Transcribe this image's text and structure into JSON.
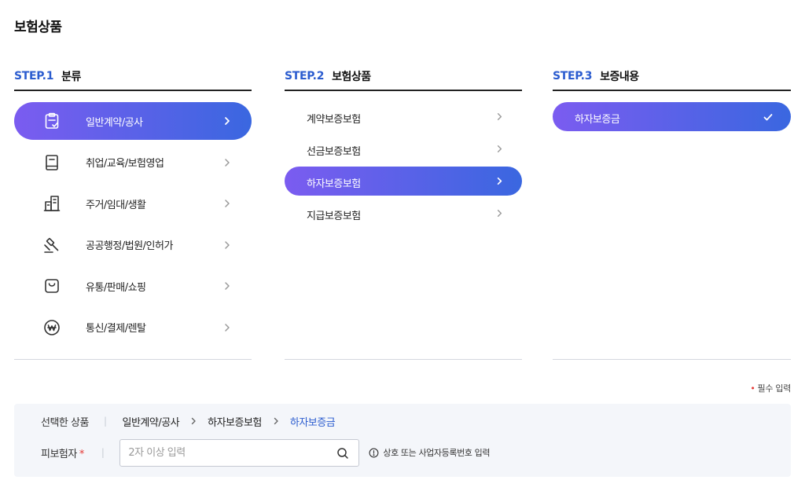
{
  "page": {
    "title": "보험상품"
  },
  "steps": [
    {
      "no": "STEP.1",
      "name": "분류"
    },
    {
      "no": "STEP.2",
      "name": "보험상품"
    },
    {
      "no": "STEP.3",
      "name": "보증내용"
    }
  ],
  "categories": [
    {
      "label": "일반계약/공사",
      "icon": "clipboard-check-icon",
      "active": true
    },
    {
      "label": "취업/교육/보험영업",
      "icon": "book-icon",
      "active": false
    },
    {
      "label": "주거/임대/생활",
      "icon": "building-icon",
      "active": false
    },
    {
      "label": "공공행정/법원/인허가",
      "icon": "gavel-icon",
      "active": false
    },
    {
      "label": "유통/판매/쇼핑",
      "icon": "shopping-bag-icon",
      "active": false
    },
    {
      "label": "통신/결제/렌탈",
      "icon": "won-coin-icon",
      "active": false
    }
  ],
  "products": [
    {
      "label": "계약보증보험",
      "active": false
    },
    {
      "label": "선금보증보험",
      "active": false
    },
    {
      "label": "하자보증보험",
      "active": true
    },
    {
      "label": "지급보증보험",
      "active": false
    }
  ],
  "coverages": [
    {
      "label": "하자보증금",
      "selected": true
    }
  ],
  "required_note": "필수 입력",
  "summary": {
    "selected_label": "선택한 상품",
    "path": [
      "일반계약/공사",
      "하자보증보험",
      "하자보증금"
    ],
    "insured_label": "피보험자",
    "search": {
      "placeholder": "2자 이상 입력",
      "value": ""
    },
    "hint": "상호 또는 사업자등록번호 입력"
  },
  "colors": {
    "accent": "#2b5ccf",
    "gradient_start": "#7b5cf0",
    "gradient_end": "#3a67e0",
    "required": "#e53935"
  }
}
